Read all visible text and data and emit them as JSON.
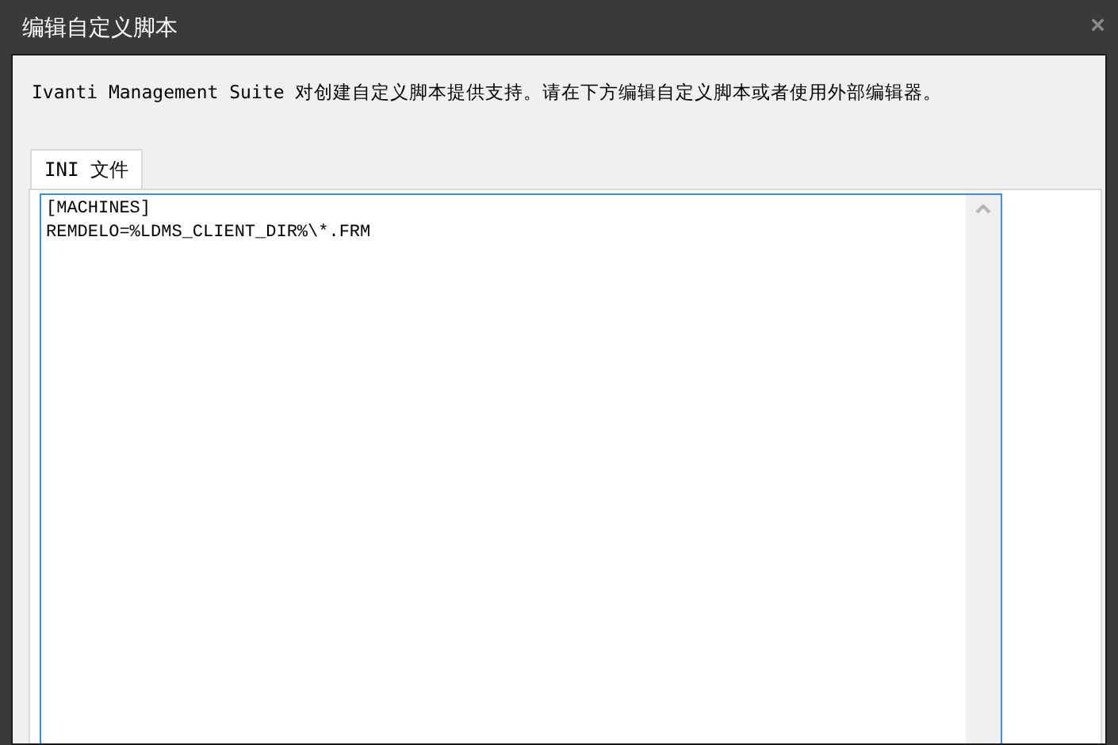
{
  "window": {
    "title": "编辑自定义脚本",
    "close": "×"
  },
  "description": "Ivanti Management Suite 对创建自定义脚本提供支持。请在下方编辑自定义脚本或者使用外部编辑器。",
  "tabs": [
    {
      "label": "INI 文件",
      "selected": true
    }
  ],
  "editor": {
    "lines": [
      "[MACHINES]",
      "REMDELO=%LDMS_CLIENT_DIR%\\*.FRM"
    ]
  }
}
